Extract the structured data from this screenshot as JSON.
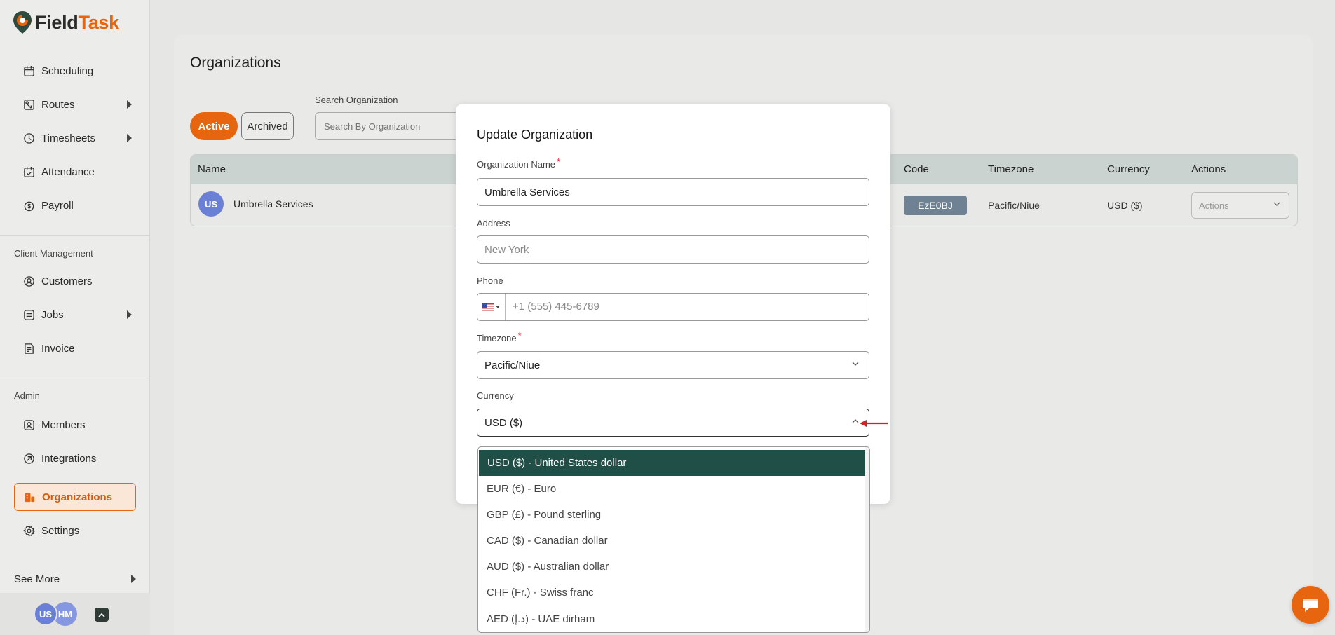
{
  "brand": {
    "field": "Field",
    "task": "Task"
  },
  "sidebar": {
    "items": [
      {
        "label": "Scheduling",
        "icon": "calendar-icon"
      },
      {
        "label": "Routes",
        "icon": "route-map-icon"
      },
      {
        "label": "Timesheets",
        "icon": "clock-icon"
      },
      {
        "label": "Attendance",
        "icon": "attendance-icon"
      },
      {
        "label": "Payroll",
        "icon": "dollar-circle-icon"
      }
    ],
    "client_section": "Client Management",
    "client_items": [
      {
        "label": "Customers",
        "icon": "user-circle-icon"
      },
      {
        "label": "Jobs",
        "icon": "jobs-icon"
      },
      {
        "label": "Invoice",
        "icon": "invoice-icon"
      }
    ],
    "admin_section": "Admin",
    "admin_items": [
      {
        "label": "Members",
        "icon": "members-icon"
      },
      {
        "label": "Integrations",
        "icon": "integrations-icon"
      },
      {
        "label": "Organizations",
        "icon": "organizations-icon"
      },
      {
        "label": "Settings",
        "icon": "gear-icon"
      }
    ],
    "see_more": "See More",
    "users": [
      "US",
      "HM"
    ]
  },
  "page": {
    "title": "Organizations",
    "tabs": {
      "active": "Active",
      "archived": "Archived"
    },
    "search": {
      "label": "Search Organization",
      "placeholder": "Search By Organization"
    }
  },
  "table": {
    "headers": {
      "name": "Name",
      "code": "Code",
      "timezone": "Timezone",
      "currency": "Currency",
      "actions": "Actions"
    },
    "rows": [
      {
        "initials": "US",
        "name": "Umbrella Services",
        "code": "EzE0BJ",
        "timezone": "Pacific/Niue",
        "currency": "USD ($)",
        "actions_placeholder": "Actions"
      }
    ]
  },
  "modal": {
    "title": "Update Organization",
    "org_name_label": "Organization Name",
    "org_name_value": "Umbrella Services",
    "address_label": "Address",
    "address_value": "New York",
    "phone_label": "Phone",
    "phone_value": "+1 (555) 445-6789",
    "timezone_label": "Timezone",
    "timezone_value": "Pacific/Niue",
    "currency_label": "Currency",
    "currency_value": "USD ($)",
    "required_mark": "*"
  },
  "currency_options": [
    "USD ($) - United States dollar",
    "EUR (€) - Euro",
    "GBP (£) - Pound sterling",
    "CAD ($) - Canadian dollar",
    "AUD ($) - Australian dollar",
    "CHF (Fr.) - Swiss franc",
    "AED (د.إ) - UAE dirham"
  ],
  "colors": {
    "accent": "#e8650f",
    "selected_option": "#1f4f47",
    "code_badge": "#6e8294"
  }
}
